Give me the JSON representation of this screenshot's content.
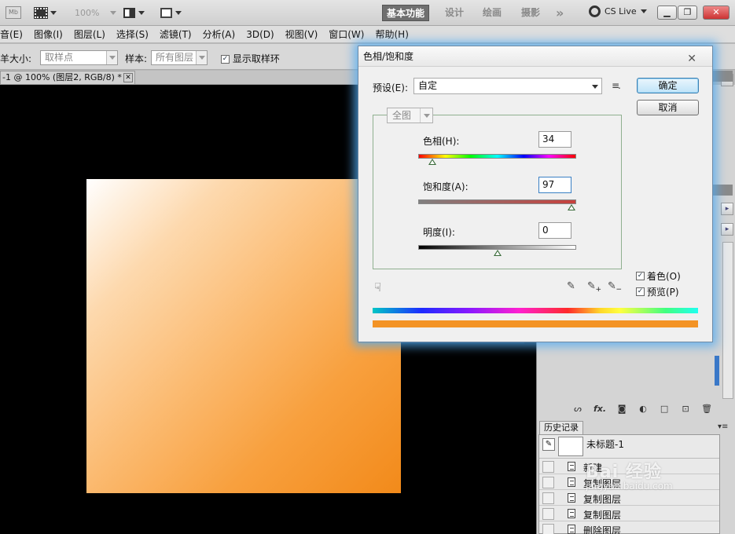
{
  "appbar": {
    "mb": "Mb",
    "zoom": "100%",
    "workspaces": [
      "基本功能",
      "设计",
      "绘画",
      "摄影"
    ],
    "more": "»",
    "cslive": "CS Live"
  },
  "menu": [
    "音(E)",
    "图像(I)",
    "图层(L)",
    "选择(S)",
    "滤镜(T)",
    "分析(A)",
    "3D(D)",
    "视图(V)",
    "窗口(W)",
    "帮助(H)"
  ],
  "options": {
    "size_label": "羊大小:",
    "size_value": "取样点",
    "sample_label": "样本:",
    "sample_value": "所有图层",
    "ring_label": "显示取样环",
    "ring_checked": "✓"
  },
  "doc": {
    "tab_title": "-1 @ 100% (图层2, RGB/8) *",
    "close": "✕"
  },
  "dialog": {
    "title": "色相/饱和度",
    "close": "✕",
    "preset_label": "预设(E):",
    "preset_value": "自定",
    "preset_menu": "≡.",
    "ok": "确定",
    "cancel": "取消",
    "edit_value": "全图",
    "hue_label": "色相(H):",
    "hue_value": "34",
    "sat_label": "饱和度(A):",
    "sat_value": "97",
    "light_label": "明度(I):",
    "light_value": "0",
    "hand_icon": "☟",
    "colorize_label": "着色(O)",
    "colorize_checked": "✓",
    "preview_label": "预览(P)",
    "preview_checked": "✓",
    "dropper_plus": "+",
    "dropper_minus": "−",
    "dropper_glyph": "✎"
  },
  "panel": {
    "layer_icons": [
      "ᔕ",
      "fx.",
      "◙",
      "◐",
      "□",
      "⊡",
      "🗑"
    ],
    "history_tab": "历史记录",
    "history_menu": "▾≡",
    "snapshot_name": "未标题-1",
    "snapshot_brush": "✎",
    "history_items": [
      "新建",
      "复制图层",
      "复制图层",
      "复制图层",
      "删除图层"
    ]
  },
  "watermark": {
    "text": "Bai 经验",
    "sub": "jingyan.baidu.com"
  },
  "colors": {
    "artwork_start": "#ffffff",
    "artwork_end": "#f28a1a",
    "orange_bar": "#f39325",
    "dialog_glow": "#50aaf0"
  },
  "sliders": {
    "hue_fraction": 0.09,
    "saturation_fraction": 0.97,
    "lightness_fraction": 0.5
  }
}
